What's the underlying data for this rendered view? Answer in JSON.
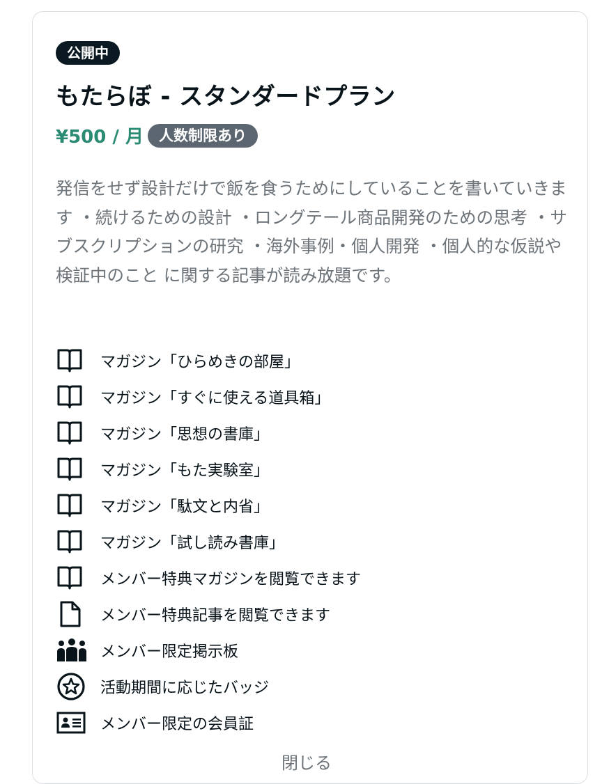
{
  "plan": {
    "status": "公開中",
    "title": "もたらぼ - スタンダードプラン",
    "price": "¥500 / 月",
    "limit_badge": "人数制限あり",
    "description": "発信をせず設計だけで飯を食うためにしていることを書いていきます ・続けるための設計 ・ロングテール商品開発のための思考 ・サブスクリプションの研究 ・海外事例・個人開発 ・個人的な仮説や検証中のこと に関する記事が読み放題です。"
  },
  "benefits": [
    {
      "icon": "magazine-icon",
      "label": "マガジン「ひらめきの部屋」"
    },
    {
      "icon": "magazine-icon",
      "label": "マガジン「すぐに使える道具箱」"
    },
    {
      "icon": "magazine-icon",
      "label": "マガジン「思想の書庫」"
    },
    {
      "icon": "magazine-icon",
      "label": "マガジン「もた実験室」"
    },
    {
      "icon": "magazine-icon",
      "label": "マガジン「駄文と内省」"
    },
    {
      "icon": "magazine-icon",
      "label": "マガジン「試し読み書庫」"
    },
    {
      "icon": "magazine-icon",
      "label": "メンバー特典マガジンを閲覧できます"
    },
    {
      "icon": "article-icon",
      "label": "メンバー特典記事を閲覧できます"
    },
    {
      "icon": "members-icon",
      "label": "メンバー限定掲示板"
    },
    {
      "icon": "badge-star-icon",
      "label": "活動期間に応じたバッジ"
    },
    {
      "icon": "member-card-icon",
      "label": "メンバー限定の会員証"
    }
  ],
  "close_label": "閉じる",
  "colors": {
    "accent_green": "#2a8a72",
    "status_badge_bg": "#0b1a22",
    "limit_badge_bg": "#5c6670",
    "description_text": "#6c7379"
  }
}
